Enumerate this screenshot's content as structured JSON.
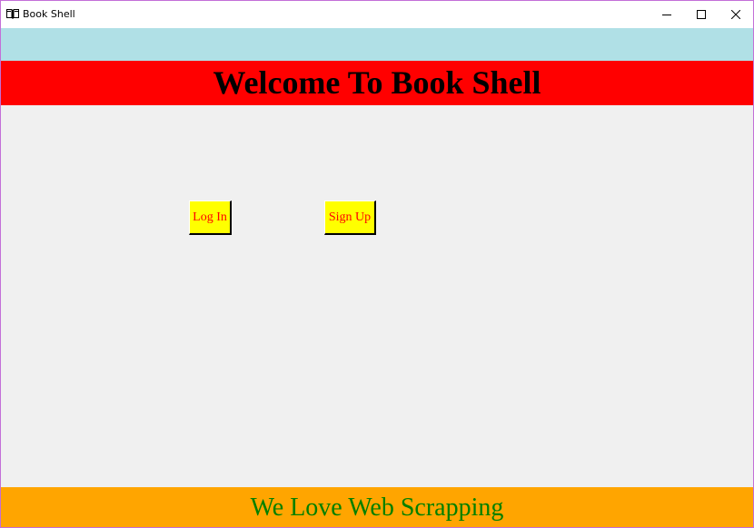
{
  "window": {
    "title": "Book Shell",
    "icon": "book-icon",
    "controls": [
      "minimize-icon",
      "maximize-icon",
      "close-icon"
    ]
  },
  "header": {
    "title": "Welcome To Book Shell"
  },
  "actions": {
    "login_label": "Log In",
    "signup_label": "Sign Up"
  },
  "footer": {
    "text": "We Love Web Scrapping"
  },
  "colors": {
    "top_band": "#b0e0e6",
    "header_band": "#ff0000",
    "body_background": "#f0f0f0",
    "button_background": "#ffff00",
    "button_text": "#ff0000",
    "footer_band": "#ffa500",
    "footer_text": "#008000"
  }
}
